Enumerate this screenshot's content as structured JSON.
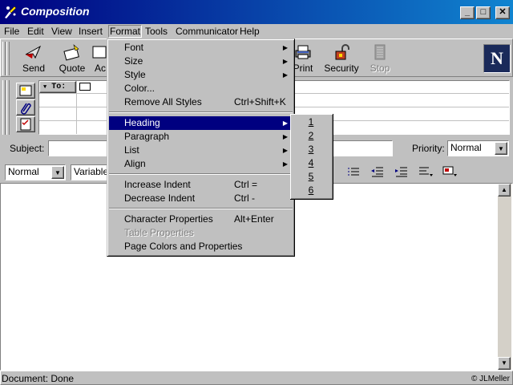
{
  "window": {
    "title": "Composition",
    "minimize": "_",
    "maximize": "□",
    "close": "✕"
  },
  "menubar": {
    "items": [
      {
        "label": "File"
      },
      {
        "label": "Edit"
      },
      {
        "label": "View"
      },
      {
        "label": "Insert"
      },
      {
        "label": "Format"
      },
      {
        "label": "Tools"
      },
      {
        "label": "Communicator"
      },
      {
        "label": "Help"
      }
    ]
  },
  "toolbar": {
    "send": "Send",
    "quote": "Quote",
    "address": "Ac",
    "print": "Print",
    "security": "Security",
    "stop": "Stop"
  },
  "address": {
    "to_label": "To:"
  },
  "subject": {
    "label": "Subject:",
    "value": ""
  },
  "priority": {
    "label": "Priority:",
    "value": "Normal"
  },
  "format_bar": {
    "style": "Normal",
    "font": "Variable"
  },
  "format_menu": {
    "items": [
      {
        "label": "Font",
        "shortcut": ""
      },
      {
        "label": "Size",
        "shortcut": ""
      },
      {
        "label": "Style",
        "shortcut": ""
      },
      {
        "label": "Color...",
        "shortcut": ""
      },
      {
        "label": "Remove All Styles",
        "shortcut": "Ctrl+Shift+K"
      },
      {
        "label": "Heading",
        "shortcut": ""
      },
      {
        "label": "Paragraph",
        "shortcut": ""
      },
      {
        "label": "List",
        "shortcut": ""
      },
      {
        "label": "Align",
        "shortcut": ""
      },
      {
        "label": "Increase Indent",
        "shortcut": "Ctrl ="
      },
      {
        "label": "Decrease Indent",
        "shortcut": "Ctrl -"
      },
      {
        "label": "Character Properties",
        "shortcut": "Alt+Enter"
      },
      {
        "label": "Table Properties",
        "shortcut": ""
      },
      {
        "label": "Page Colors and Properties",
        "shortcut": ""
      }
    ]
  },
  "heading_submenu": {
    "items": [
      "1",
      "2",
      "3",
      "4",
      "5",
      "6"
    ]
  },
  "status": {
    "text": "Document: Done",
    "copyright": "© JLMeller"
  },
  "colors": {
    "titlebar": "#000080",
    "highlight": "#000080",
    "face": "#c0c0c0"
  },
  "icons": [
    "send-icon",
    "quote-icon",
    "print-icon",
    "security-icon",
    "stop-icon",
    "netscape-logo"
  ]
}
